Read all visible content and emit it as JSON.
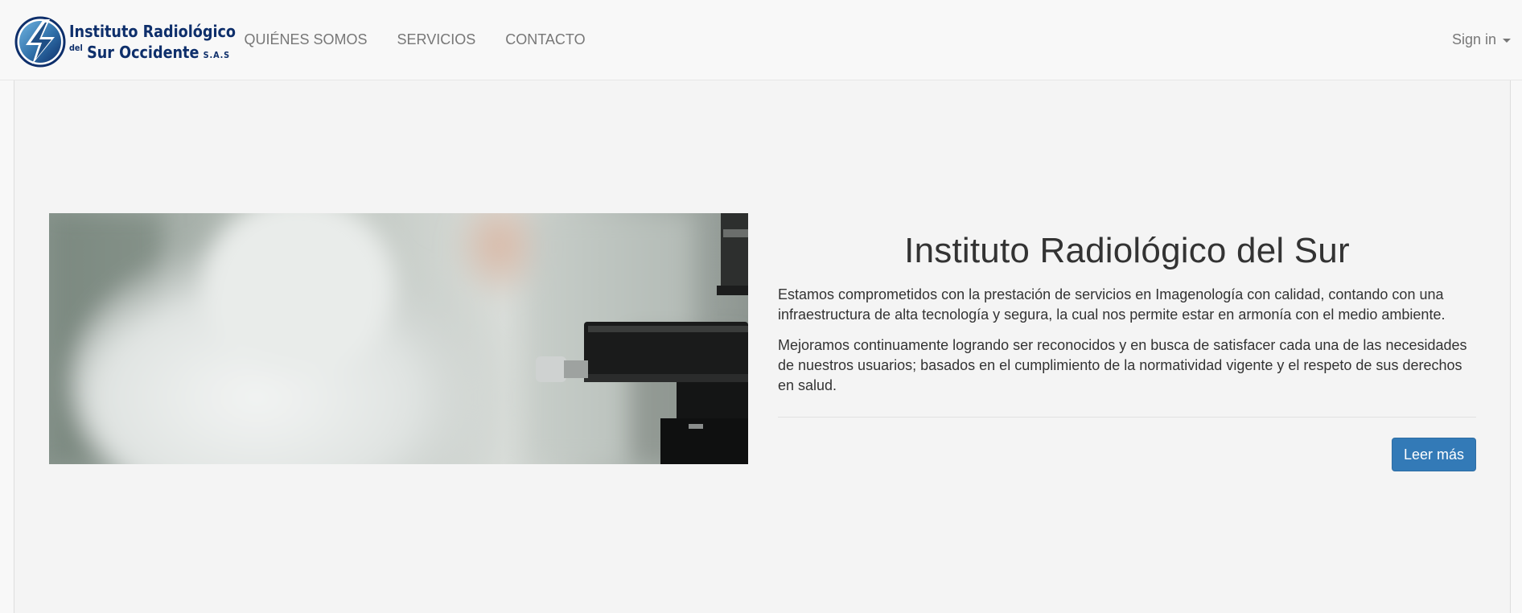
{
  "brand": {
    "line1": "Instituto Radiológico",
    "line2_del": "del",
    "line2_main": "Sur Occidente",
    "line2_suffix": "S.A.S",
    "logo_icon": "lightning-bolt-circle-icon",
    "colors": {
      "primary": "#0e2f6b",
      "accent": "#3a86c8"
    }
  },
  "nav": {
    "items": [
      {
        "label": "QUIÉNES SOMOS"
      },
      {
        "label": "SERVICIOS"
      },
      {
        "label": "CONTACTO"
      }
    ],
    "signin_label": "Sign in"
  },
  "hero": {
    "title": "Instituto Radiológico del Sur",
    "paragraphs": [
      "Estamos comprometidos con la prestación de servicios en Imagenología con calidad, contando con una infraestructura de alta tecnología y segura, la cual nos permite estar en armonía con el medio ambiente.",
      "Mejoramos continuamente logrando ser reconocidos y en busca de satisfacer cada una de las necesidades de nuestros usuarios; basados en el cumplimiento de la normatividad vigente y el respeto de sus derechos en salud."
    ],
    "button_label": "Leer más",
    "button_color": "#337ab7"
  }
}
